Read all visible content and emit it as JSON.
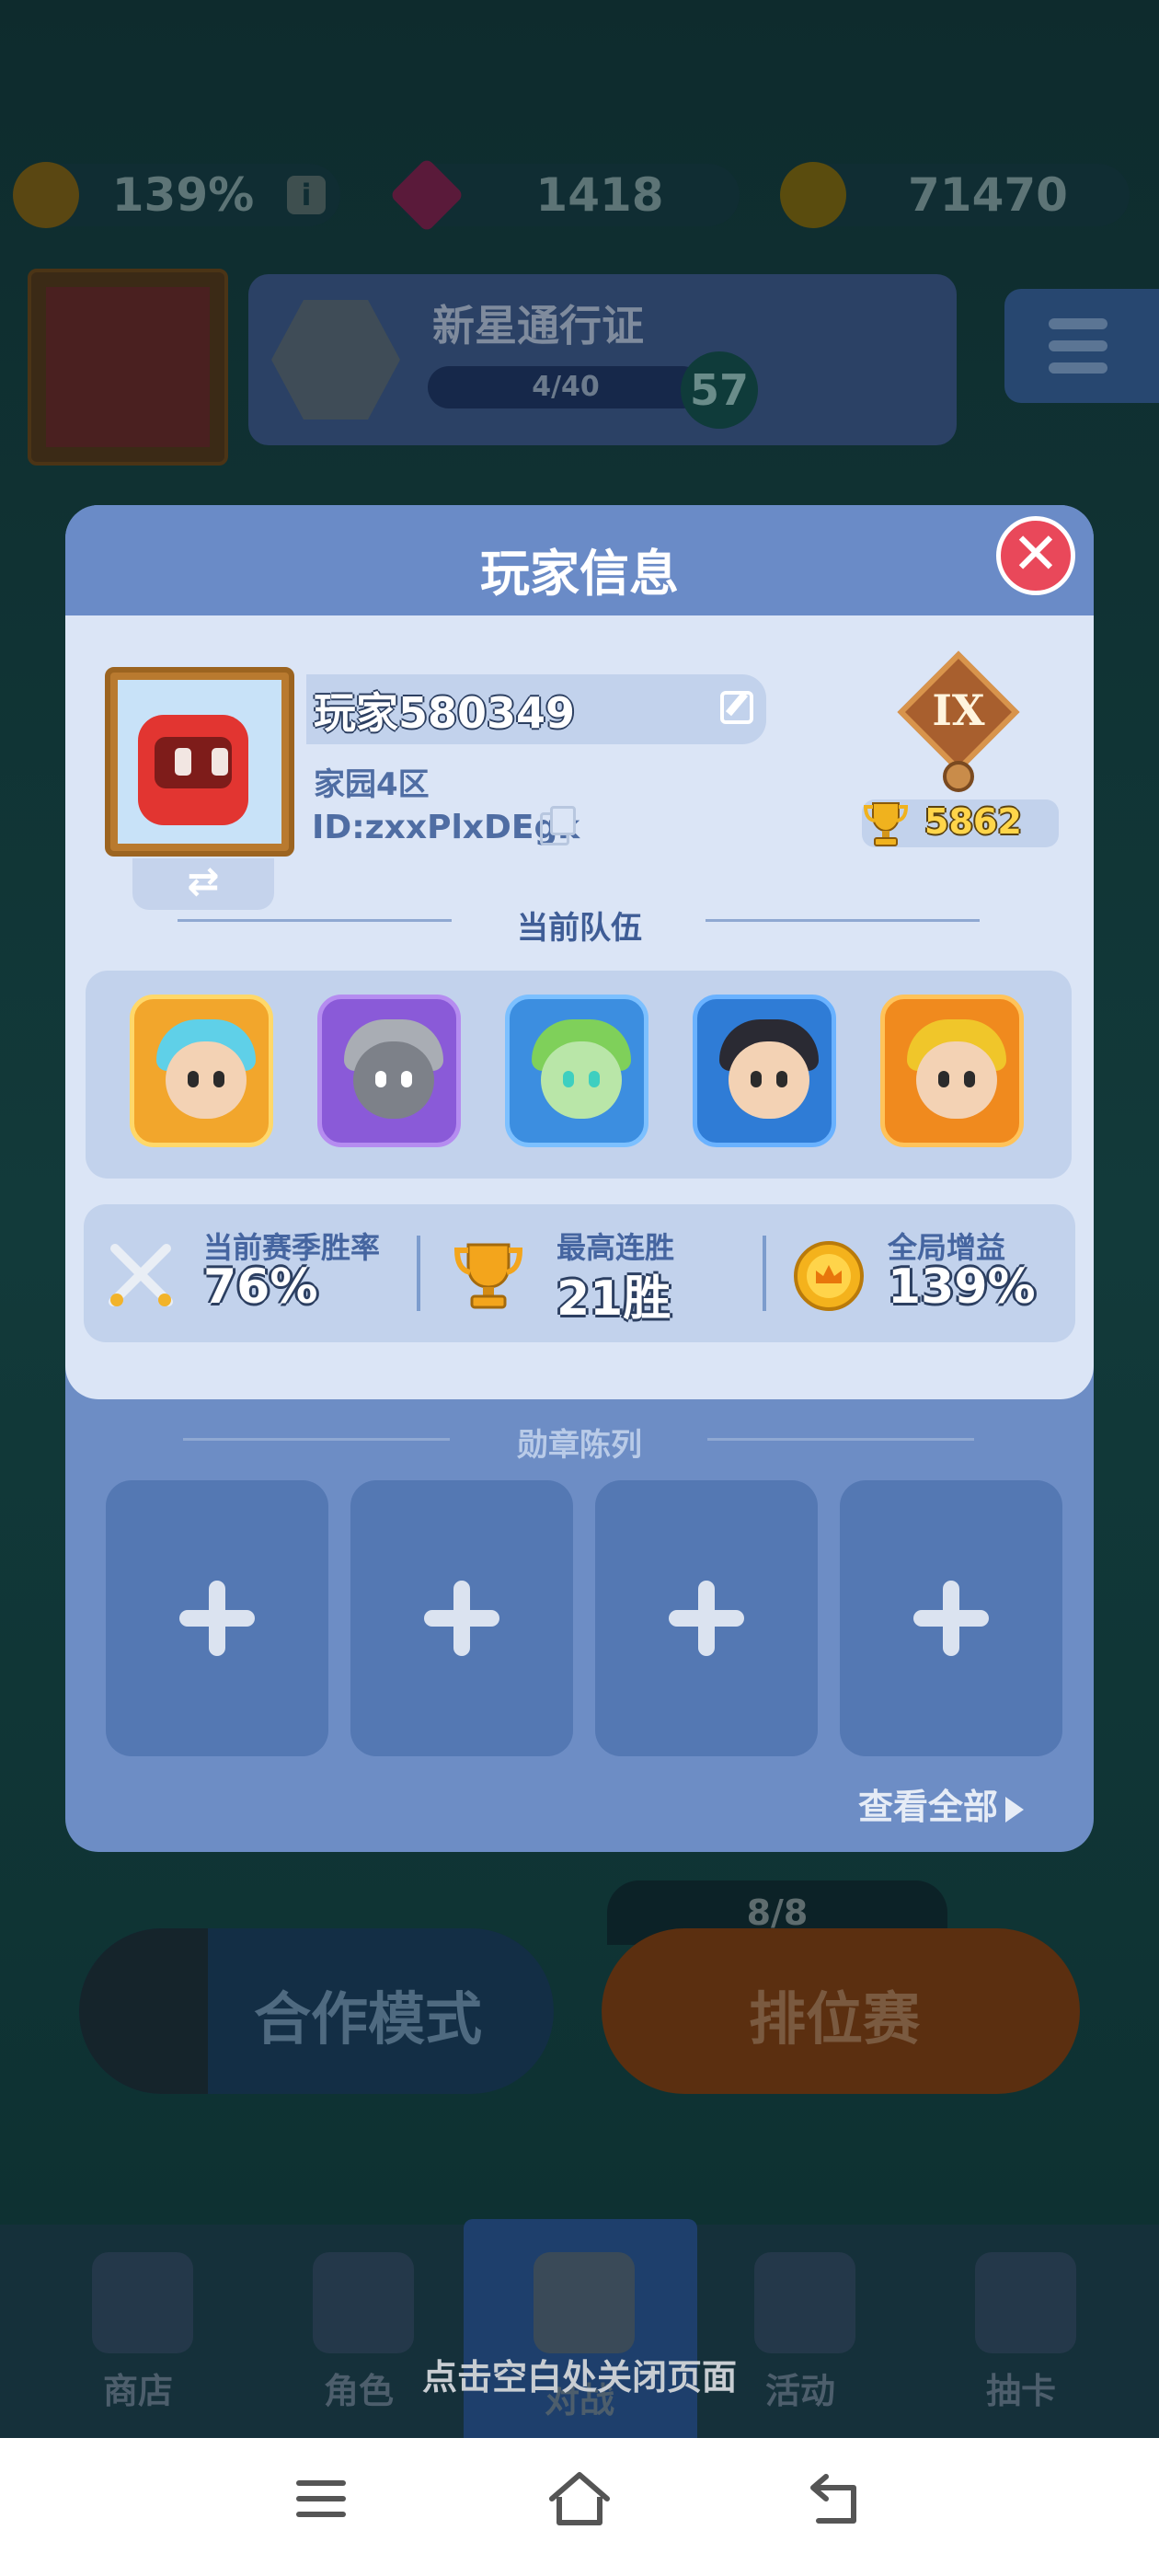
{
  "resources": {
    "boost_percent": "139%",
    "gems": "1418",
    "coins": "71470"
  },
  "pass": {
    "title": "新星通行证",
    "progress_text": "4/40",
    "progress_fraction": 0.1,
    "level": "57"
  },
  "modal": {
    "title": "玩家信息",
    "player": {
      "name": "玩家580349",
      "server": "家园4区",
      "id": "ID:zxxPlxDEgk",
      "rank_numeral": "IX",
      "trophies": "5862"
    },
    "team_section_title": "当前队伍",
    "team": [
      {
        "icon": "ice-mage-hero"
      },
      {
        "icon": "knight-hero"
      },
      {
        "icon": "nature-fairy-hero"
      },
      {
        "icon": "cheerleader-hero"
      },
      {
        "icon": "fire-warrior-hero"
      }
    ],
    "stats": [
      {
        "label": "当前赛季胜率",
        "value": "76%",
        "icon": "crossed-swords-icon"
      },
      {
        "label": "最高连胜",
        "value": "21胜",
        "icon": "trophy-icon"
      },
      {
        "label": "全局增益",
        "value": "139%",
        "icon": "boost-crown-icon"
      }
    ],
    "medal_section_title": "勋章陈列",
    "medal_slots": 4,
    "view_all_label": "查看全部"
  },
  "modes": {
    "coop_label": "合作模式",
    "ranked_label": "排位赛",
    "ticket_count": "8/8"
  },
  "tabbar": {
    "items": [
      {
        "label": "商店",
        "icon": "shop-icon"
      },
      {
        "label": "角色",
        "icon": "character-icon"
      },
      {
        "label": "对战",
        "icon": "battle-icon"
      },
      {
        "label": "活动",
        "icon": "star-shield-icon"
      },
      {
        "label": "抽卡",
        "icon": "mystery-card-icon"
      }
    ]
  },
  "close_hint": "点击空白处关闭页面",
  "colors": {
    "modal_blue": "#6d8dc5",
    "panel_light": "#dbe5f6",
    "close_red": "#e9485a",
    "trophy_gold": "#ffd54a"
  }
}
